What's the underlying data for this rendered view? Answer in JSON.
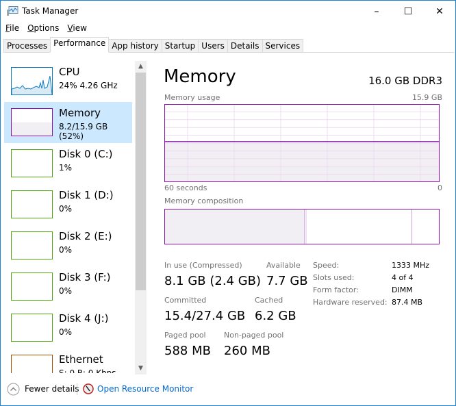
{
  "window": {
    "title": "Task Manager",
    "minimize": "–",
    "maximize": "☐",
    "close": "✕"
  },
  "menu": [
    "File",
    "Options",
    "View"
  ],
  "tabs": [
    "Processes",
    "Performance",
    "App history",
    "Startup",
    "Users",
    "Details",
    "Services"
  ],
  "active_tab": "Performance",
  "sidebar": [
    {
      "name": "CPU",
      "value": "24%  4.26 GHz",
      "color": "#117dbb"
    },
    {
      "name": "Memory",
      "value": "8.2/15.9 GB (52%)",
      "color": "#8b12ae",
      "selected": true
    },
    {
      "name": "Disk 0 (C:)",
      "value": "1%",
      "color": "#4da60c"
    },
    {
      "name": "Disk 1 (D:)",
      "value": "0%",
      "color": "#4da60c"
    },
    {
      "name": "Disk 2 (E:)",
      "value": "0%",
      "color": "#4da60c"
    },
    {
      "name": "Disk 3 (F:)",
      "value": "0%",
      "color": "#4da60c"
    },
    {
      "name": "Disk 4 (J:)",
      "value": "0%",
      "color": "#4da60c"
    },
    {
      "name": "Ethernet",
      "value": "S: 0 R: 0 Kbps",
      "color": "#a74f01"
    }
  ],
  "main": {
    "title": "Memory",
    "spec": "16.0 GB DDR3",
    "usage_label": "Memory usage",
    "usage_max": "15.9 GB",
    "time_left": "60 seconds",
    "time_right": "0",
    "composition_label": "Memory composition",
    "usage_percent": 52,
    "composition": {
      "in_use_gb": 8.1,
      "modified_gb": 0.1,
      "standby_gb": 6.1,
      "free_gb": 1.6
    },
    "stats": {
      "in_use_label": "In use (Compressed)",
      "in_use": "8.1 GB (2.4 GB)",
      "available_label": "Available",
      "available": "7.7 GB",
      "committed_label": "Committed",
      "committed": "15.4/27.4 GB",
      "cached_label": "Cached",
      "cached": "6.2 GB",
      "paged_label": "Paged pool",
      "paged": "588 MB",
      "nonpaged_label": "Non-paged pool",
      "nonpaged": "260 MB"
    },
    "specs": [
      {
        "k": "Speed:",
        "v": "1333 MHz"
      },
      {
        "k": "Slots used:",
        "v": "4 of 4"
      },
      {
        "k": "Form factor:",
        "v": "DIMM"
      },
      {
        "k": "Hardware reserved:",
        "v": "87.4 MB"
      }
    ]
  },
  "footer": {
    "fewer": "Fewer details",
    "monitor": "Open Resource Monitor"
  }
}
